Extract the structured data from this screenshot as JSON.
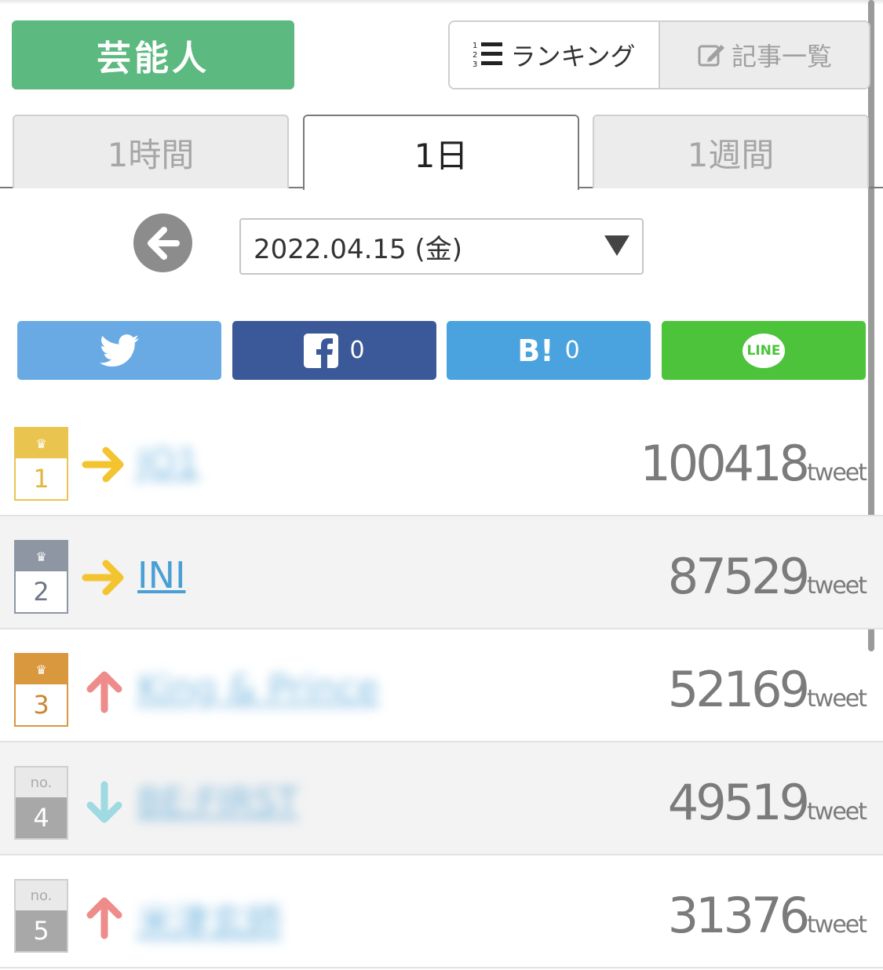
{
  "header": {
    "category_label": "芸能人",
    "view_ranking_label": "ランキング",
    "view_articles_label": "記事一覧"
  },
  "period_tabs": [
    "1時間",
    "1日",
    "1週間"
  ],
  "active_tab": "1日",
  "date_selector": {
    "value": "2022.04.15 (金)"
  },
  "share": {
    "facebook_count": "0",
    "hatena_label": "B!",
    "hatena_count": "0",
    "line_label": "LINE"
  },
  "ranking": [
    {
      "rank": "1",
      "badge": "gold",
      "trend": "flat",
      "name": "JO1",
      "count": "100418",
      "unit": "tweet"
    },
    {
      "rank": "2",
      "badge": "silver",
      "trend": "flat",
      "name": "INI",
      "count": "87529",
      "unit": "tweet"
    },
    {
      "rank": "3",
      "badge": "bronze",
      "trend": "up",
      "name": "King & Prince",
      "count": "52169",
      "unit": "tweet"
    },
    {
      "rank": "4",
      "badge": "no",
      "badge_label": "no.",
      "trend": "down",
      "name": "BE:FIRST",
      "count": "49519",
      "unit": "tweet"
    },
    {
      "rank": "5",
      "badge": "no",
      "badge_label": "no.",
      "trend": "up",
      "name": "米津玄師",
      "count": "31376",
      "unit": "tweet"
    }
  ],
  "colors": {
    "category_green": "#5cb97f",
    "twitter": "#6aaae4",
    "facebook": "#3b5998",
    "hatena": "#4aa3df",
    "line": "#4cc33b",
    "gold": "#e9c54f",
    "silver": "#8e96a4",
    "bronze": "#d9973e",
    "trend_flat": "#f4c430",
    "trend_up": "#ee8b8b",
    "trend_down": "#9fd9e2",
    "link": "#4a9fd5"
  }
}
